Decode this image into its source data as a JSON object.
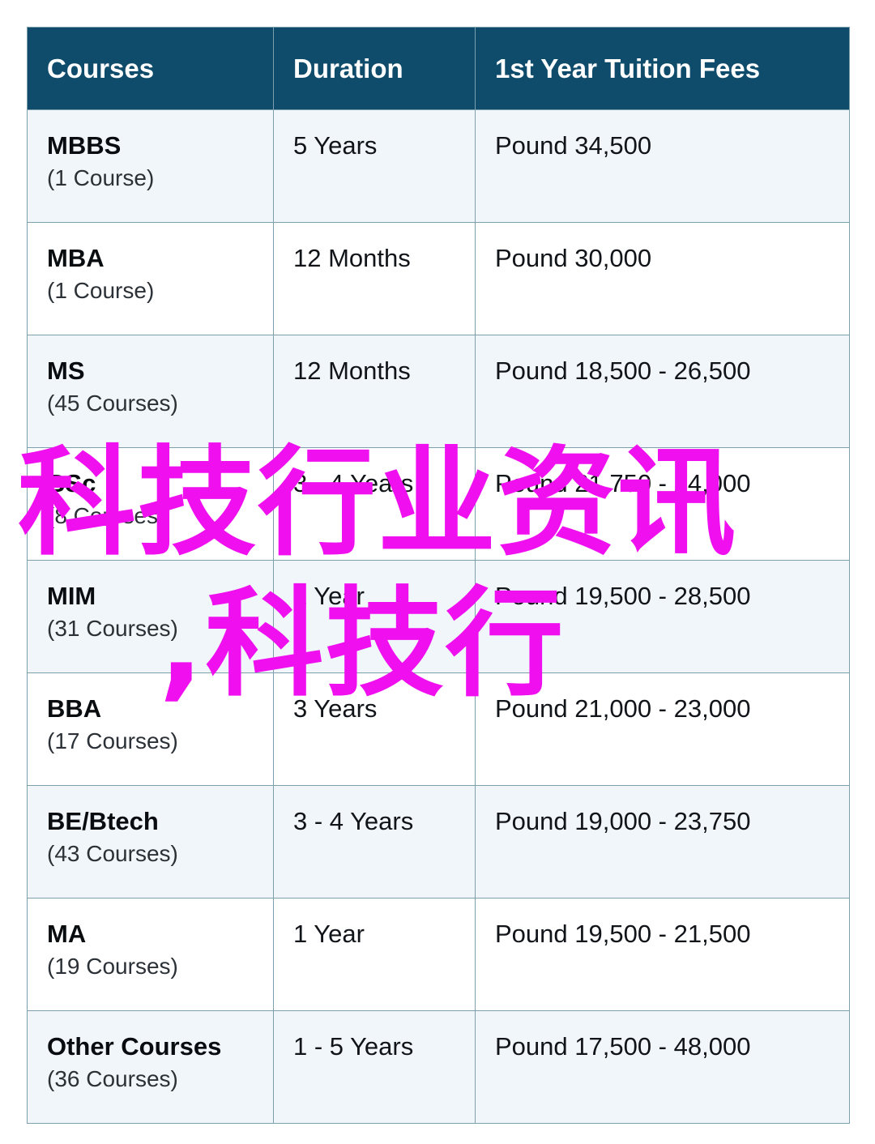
{
  "table": {
    "headers": {
      "courses": "Courses",
      "duration": "Duration",
      "fees": "1st Year Tuition Fees"
    },
    "rows": [
      {
        "course": "MBBS",
        "count": "(1 Course)",
        "duration": "5 Years",
        "fees": "Pound 34,500"
      },
      {
        "course": "MBA",
        "count": "(1 Course)",
        "duration": "12 Months",
        "fees": "Pound 30,000"
      },
      {
        "course": "MS",
        "count": "(45 Courses)",
        "duration": "12 Months",
        "fees": "Pound 18,500 - 26,500"
      },
      {
        "course": "BSc",
        "count": "(8 Courses)",
        "duration": "3 - 4 Years",
        "fees": "Pound 21,750 - 24,000"
      },
      {
        "course": "MIM",
        "count": "(31 Courses)",
        "duration": "1 Year",
        "fees": "Pound 19,500 - 28,500"
      },
      {
        "course": "BBA",
        "count": "(17 Courses)",
        "duration": "3 Years",
        "fees": "Pound 21,000 - 23,000"
      },
      {
        "course": "BE/Btech",
        "count": "(43 Courses)",
        "duration": "3 - 4 Years",
        "fees": "Pound 19,000 - 23,750"
      },
      {
        "course": "MA",
        "count": "(19 Courses)",
        "duration": "1 Year",
        "fees": "Pound 19,500 - 21,500"
      },
      {
        "course": "Other Courses",
        "count": "(36 Courses)",
        "duration": "1 - 5 Years",
        "fees": "Pound 17,500 - 48,000"
      }
    ]
  },
  "watermark": {
    "line1": "科技行业资讯",
    "line2": ",科技行",
    "color": "#ef0fef"
  },
  "colors": {
    "header_background": "#0f4c6b",
    "header_text": "#ffffff",
    "border": "#7d9fae",
    "row_odd_background": "#f1f6fb",
    "row_even_background": "#ffffff",
    "body_text": "#111418"
  }
}
